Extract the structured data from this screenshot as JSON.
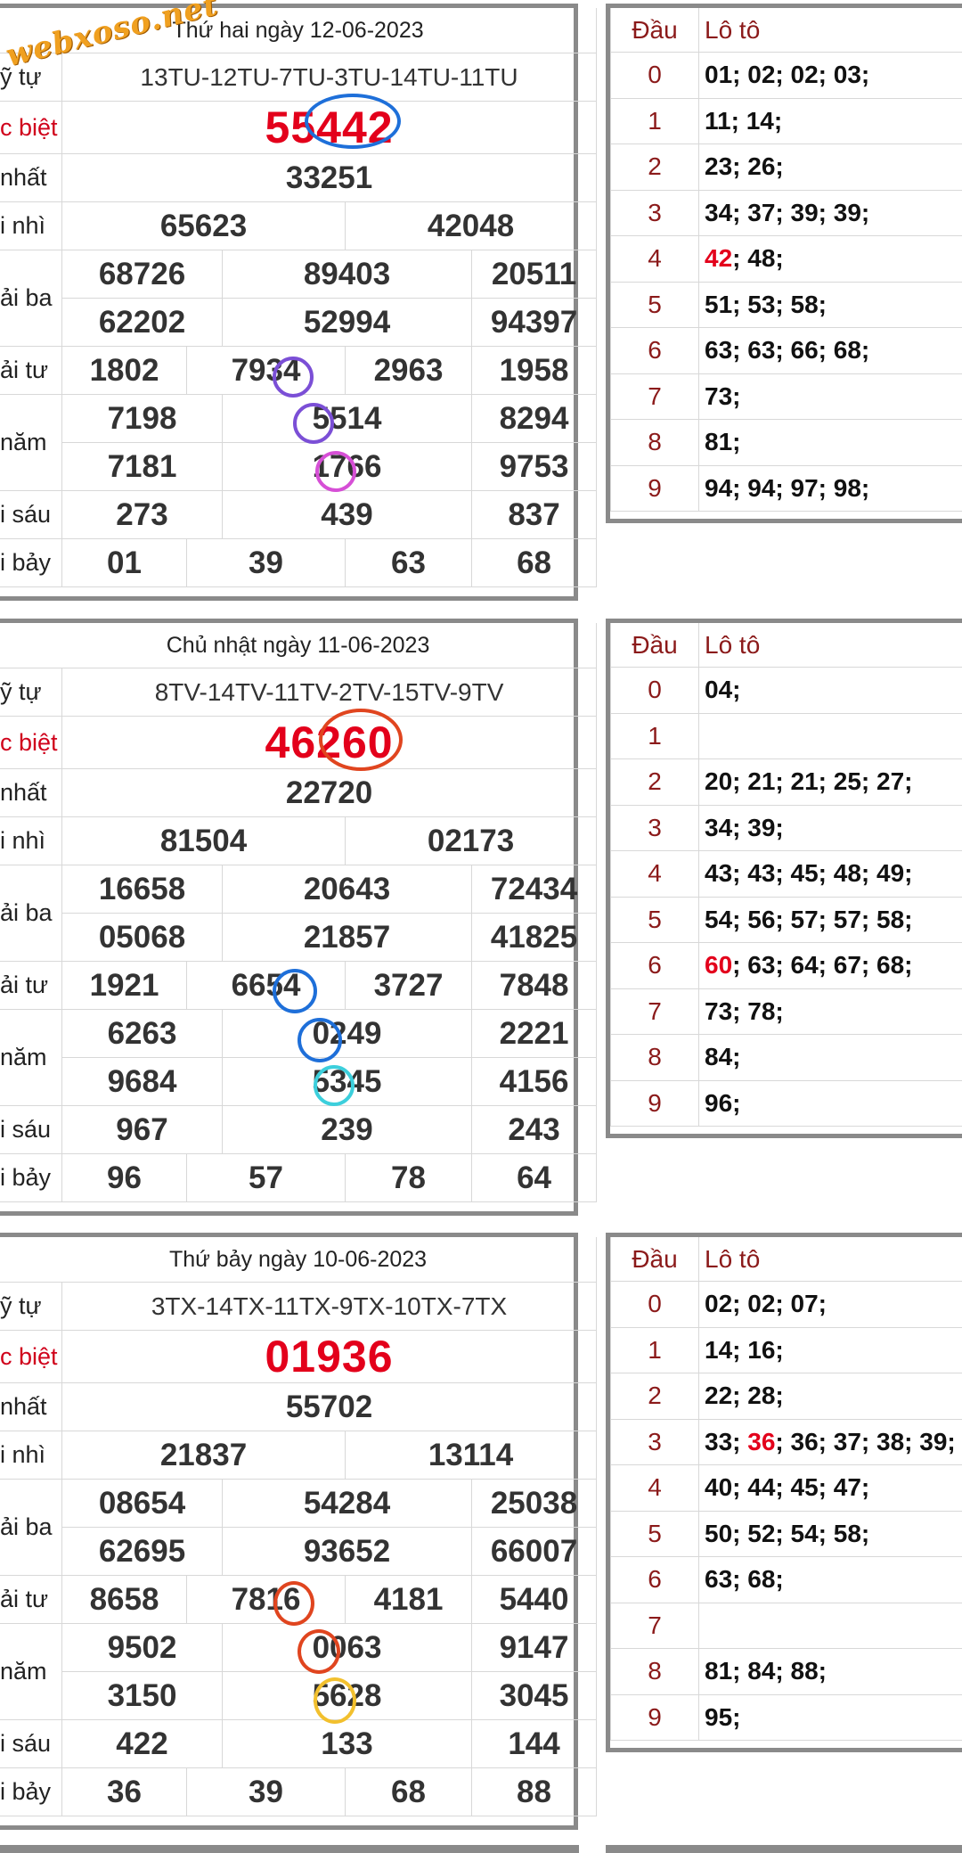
{
  "watermark": "webxoso.net",
  "labels": {
    "ky_hieu": "ỹ tự",
    "dac_biet": "c biệt",
    "nhat": " nhất",
    "nhi": "i nhì",
    "ba": "ải ba",
    "tu": "ải tư",
    "nam": " năm",
    "sau": "i sáu",
    "bay": "i bảy"
  },
  "loto_header": {
    "dau": "Đầu",
    "loto": "Lô tô"
  },
  "draws": [
    {
      "date_title": "Thứ hai ngày 12-06-2023",
      "codes": "13TU-12TU-7TU-3TU-14TU-11TU",
      "special": "55442",
      "first": "33251",
      "second": [
        "65623",
        "42048"
      ],
      "third": [
        "68726",
        "89403",
        "20511",
        "62202",
        "52994",
        "94397"
      ],
      "fourth": [
        "1802",
        "7934",
        "2963",
        "1958"
      ],
      "fifth": [
        "7198",
        "5514",
        "8294",
        "7181",
        "1766",
        "9753"
      ],
      "sixth": [
        "273",
        "439",
        "837"
      ],
      "seventh": [
        "01",
        "39",
        "63",
        "68"
      ],
      "loto": [
        {
          "dau": "0",
          "pre": "",
          "hl": "",
          "post": "01; 02; 02; 03;"
        },
        {
          "dau": "1",
          "pre": "",
          "hl": "",
          "post": "11; 14;"
        },
        {
          "dau": "2",
          "pre": "",
          "hl": "",
          "post": "23; 26;"
        },
        {
          "dau": "3",
          "pre": "",
          "hl": "",
          "post": "34; 37; 39; 39;"
        },
        {
          "dau": "4",
          "pre": "",
          "hl": "42",
          "post": "; 48;"
        },
        {
          "dau": "5",
          "pre": "",
          "hl": "",
          "post": "51; 53; 58;"
        },
        {
          "dau": "6",
          "pre": "",
          "hl": "",
          "post": "63; 63; 66; 68;"
        },
        {
          "dau": "7",
          "pre": "",
          "hl": "",
          "post": "73;"
        },
        {
          "dau": "8",
          "pre": "",
          "hl": "",
          "post": "81;"
        },
        {
          "dau": "9",
          "pre": "",
          "hl": "",
          "post": "94; 94; 97; 98;"
        }
      ],
      "ring_colors": [
        "#1e6fd9",
        "#7b4fd6",
        "#7b4fd6",
        "#d64fd6"
      ]
    },
    {
      "date_title": "Chủ nhật ngày 11-06-2023",
      "codes": "8TV-14TV-11TV-2TV-15TV-9TV",
      "special": "46260",
      "first": "22720",
      "second": [
        "81504",
        "02173"
      ],
      "third": [
        "16658",
        "20643",
        "72434",
        "05068",
        "21857",
        "41825"
      ],
      "fourth": [
        "1921",
        "6654",
        "3727",
        "7848"
      ],
      "fifth": [
        "6263",
        "0249",
        "2221",
        "9684",
        "5345",
        "4156"
      ],
      "sixth": [
        "967",
        "239",
        "243"
      ],
      "seventh": [
        "96",
        "57",
        "78",
        "64"
      ],
      "loto": [
        {
          "dau": "0",
          "pre": "",
          "hl": "",
          "post": "04;"
        },
        {
          "dau": "1",
          "pre": "",
          "hl": "",
          "post": ""
        },
        {
          "dau": "2",
          "pre": "",
          "hl": "",
          "post": "20; 21; 21; 25; 27;"
        },
        {
          "dau": "3",
          "pre": "",
          "hl": "",
          "post": "34; 39;"
        },
        {
          "dau": "4",
          "pre": "",
          "hl": "",
          "post": "43; 43; 45; 48; 49;"
        },
        {
          "dau": "5",
          "pre": "",
          "hl": "",
          "post": "54; 56; 57; 57; 58;"
        },
        {
          "dau": "6",
          "pre": "",
          "hl": "60",
          "post": "; 63; 64; 67; 68;"
        },
        {
          "dau": "7",
          "pre": "",
          "hl": "",
          "post": "73; 78;"
        },
        {
          "dau": "8",
          "pre": "",
          "hl": "",
          "post": "84;"
        },
        {
          "dau": "9",
          "pre": "",
          "hl": "",
          "post": "96;"
        }
      ],
      "ring_colors": [
        "#e0451f",
        "#1e6fd9",
        "#1e6fd9",
        "#3ccfdc"
      ]
    },
    {
      "date_title": "Thứ bảy ngày 10-06-2023",
      "codes": "3TX-14TX-11TX-9TX-10TX-7TX",
      "special": "01936",
      "first": "55702",
      "second": [
        "21837",
        "13114"
      ],
      "third": [
        "08654",
        "54284",
        "25038",
        "62695",
        "93652",
        "66007"
      ],
      "fourth": [
        "8658",
        "7816",
        "4181",
        "5440"
      ],
      "fifth": [
        "9502",
        "0063",
        "9147",
        "3150",
        "5628",
        "3045"
      ],
      "sixth": [
        "422",
        "133",
        "144"
      ],
      "seventh": [
        "36",
        "39",
        "68",
        "88"
      ],
      "loto": [
        {
          "dau": "0",
          "pre": "",
          "hl": "",
          "post": "02; 02; 07;"
        },
        {
          "dau": "1",
          "pre": "",
          "hl": "",
          "post": "14; 16;"
        },
        {
          "dau": "2",
          "pre": "",
          "hl": "",
          "post": "22; 28;"
        },
        {
          "dau": "3",
          "pre": "33; ",
          "hl": "36",
          "post": "; 36; 37; 38; 39;"
        },
        {
          "dau": "4",
          "pre": "",
          "hl": "",
          "post": "40; 44; 45; 47;"
        },
        {
          "dau": "5",
          "pre": "",
          "hl": "",
          "post": "50; 52; 54; 58;"
        },
        {
          "dau": "6",
          "pre": "",
          "hl": "",
          "post": "63; 68;"
        },
        {
          "dau": "7",
          "pre": "",
          "hl": "",
          "post": ""
        },
        {
          "dau": "8",
          "pre": "",
          "hl": "",
          "post": "81; 84; 88;"
        },
        {
          "dau": "9",
          "pre": "",
          "hl": "",
          "post": "95;"
        }
      ],
      "ring_colors": [
        "",
        "#e0451f",
        "#e0451f",
        "#f2c02e"
      ]
    }
  ]
}
